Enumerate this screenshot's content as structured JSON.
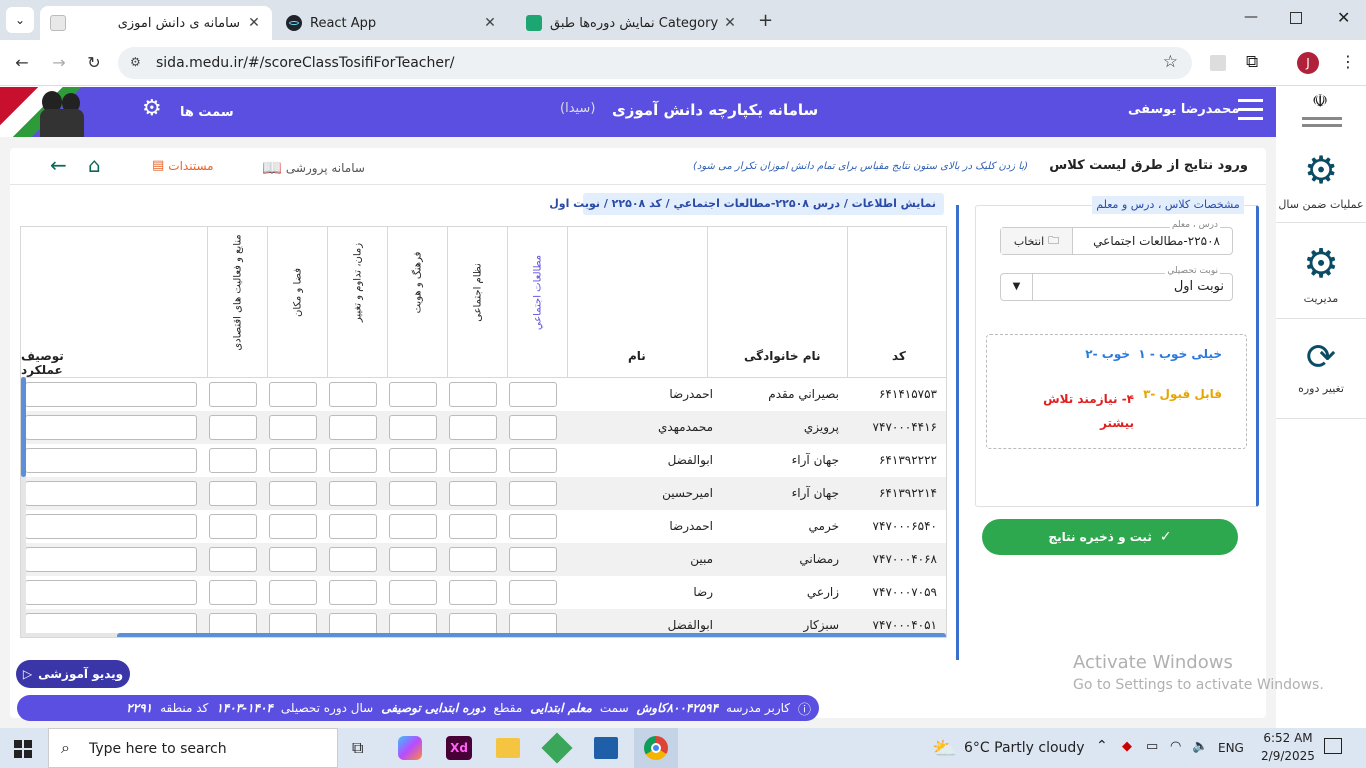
{
  "browser": {
    "tabs": [
      {
        "title": "سامانه ی دانش آموزی",
        "active": true
      },
      {
        "title": "React App",
        "active": false
      },
      {
        "title": "نمایش دوره‌ها طبق Category - آ",
        "active": false
      }
    ],
    "url": "sida.medu.ir/#/scoreClassTosifiForTeacher/",
    "profile_initial": "J"
  },
  "header": {
    "menu_icon": "hamburger-icon",
    "user_name": "محمدرضا یوسفی",
    "system_title": "سامانه یکپارچه دانش آموزی",
    "system_subtitle": "(سیدا)",
    "roles_label": "سمت ها",
    "roles_icon": "users-group-icon"
  },
  "right_nav": [
    {
      "label": "عملیات ضمن سال",
      "icon": "gear-cluster-icon"
    },
    {
      "label": "مدیریت",
      "icon": "user-gear-icon"
    },
    {
      "label": "تغییر دوره",
      "icon": "user-switch-icon"
    }
  ],
  "toolbar": {
    "page_title": "ورود نتایج از طرق لیست کلاس",
    "hint": "(با زدن کلیک در بالای ستون نتایج مقیاس برای تمام دانش آموزان تکرار می شود)",
    "docs_label": "مستندات",
    "parvareshi_label": "سامانه پرورشی",
    "home_icon": "home-icon",
    "back_icon": "arrow-left-icon"
  },
  "info_chip": "نمایش اطلاعات / درس ۲۲۵۰۸-مطالعات اجتماعي / کد ۲۲۵۰۸ / نوبت اول",
  "class_spec": {
    "section_title": "مشخصات کلاس ، درس و معلم",
    "lesson_field_label": "درس ، معلم",
    "lesson_value": "۲۲۵۰۸-مطالعات اجتماعي",
    "select_button": "انتخاب",
    "term_field_label": "نوبت تحصیلي",
    "term_value": "نوبت اول",
    "legend": [
      {
        "label": "۱ - خیلی خوب",
        "color": "#2a7be0"
      },
      {
        "label": "۲- خوب",
        "color": "#2a7be0"
      },
      {
        "label": "۳- قابل قبول",
        "color": "#e8a400"
      },
      {
        "label": "۴- نیازمند تلاش بیشتر",
        "color": "#e02020"
      }
    ],
    "save_button": "ثبت و ذخیره نتایج"
  },
  "table": {
    "headers": {
      "code": "کد",
      "family": "نام خانوادگی",
      "name": "نام",
      "description": "توصیف عملکرد",
      "scales": [
        {
          "label": "مطالعات اجتماعي",
          "highlight": true
        },
        {
          "label": "نظام اجتماعی",
          "highlight": false
        },
        {
          "label": "فرهنگ و هویت",
          "highlight": false
        },
        {
          "label": "زمان، تداوم و تغییر",
          "highlight": false
        },
        {
          "label": "فضا و مکان",
          "highlight": false
        },
        {
          "label": "منابع و فعالیت های اقتصادی",
          "highlight": false
        }
      ]
    },
    "rows": [
      {
        "code": "۶۴۱۴۱۵۷۵۳",
        "family": "بصيراني مقدم",
        "name": "احمدرضا"
      },
      {
        "code": "۷۴۷۰۰۰۴۴۱۶",
        "family": "پرويزي",
        "name": "محمدمهدي"
      },
      {
        "code": "۶۴۱۳۹۲۲۲۲",
        "family": "جهان آراء",
        "name": "ابوالفضل"
      },
      {
        "code": "۶۴۱۳۹۲۲۱۴",
        "family": "جهان آراء",
        "name": "اميرحسين"
      },
      {
        "code": "۷۴۷۰۰۰۶۵۴۰",
        "family": "خرمي",
        "name": "احمدرضا"
      },
      {
        "code": "۷۴۷۰۰۰۴۰۶۸",
        "family": "رمضاني",
        "name": "مبين"
      },
      {
        "code": "۷۴۷۰۰۰۷۰۵۹",
        "family": "زارعي",
        "name": "رضا"
      },
      {
        "code": "۷۴۷۰۰۰۴۰۵۱",
        "family": "سبزکار",
        "name": "ابوالفضل"
      }
    ]
  },
  "video_button": "ویدیو آموزشی",
  "info_bar": {
    "user_label": "کاربر مدرسه",
    "user_value": "۸۰۰۴۲۵۹۴کاوش",
    "role_label": "سمت",
    "role_value": "معلم ابتدایی",
    "level_label": "مقطع",
    "level_value": "دوره ابتدایی توصیفی",
    "year_label": "سال دوره تحصیلی",
    "year_value": "۱۴۰۳-۱۴۰۴",
    "region_label": "کد منطقه",
    "region_value": "۲۲۹۱"
  },
  "watermark": {
    "title": "Activate Windows",
    "sub": "Go to Settings to activate Windows."
  },
  "taskbar": {
    "search_placeholder": "Type here to search",
    "weather": "6°C  Partly cloudy",
    "lang": "ENG",
    "time": "6:52 AM",
    "date": "2/9/2025"
  }
}
